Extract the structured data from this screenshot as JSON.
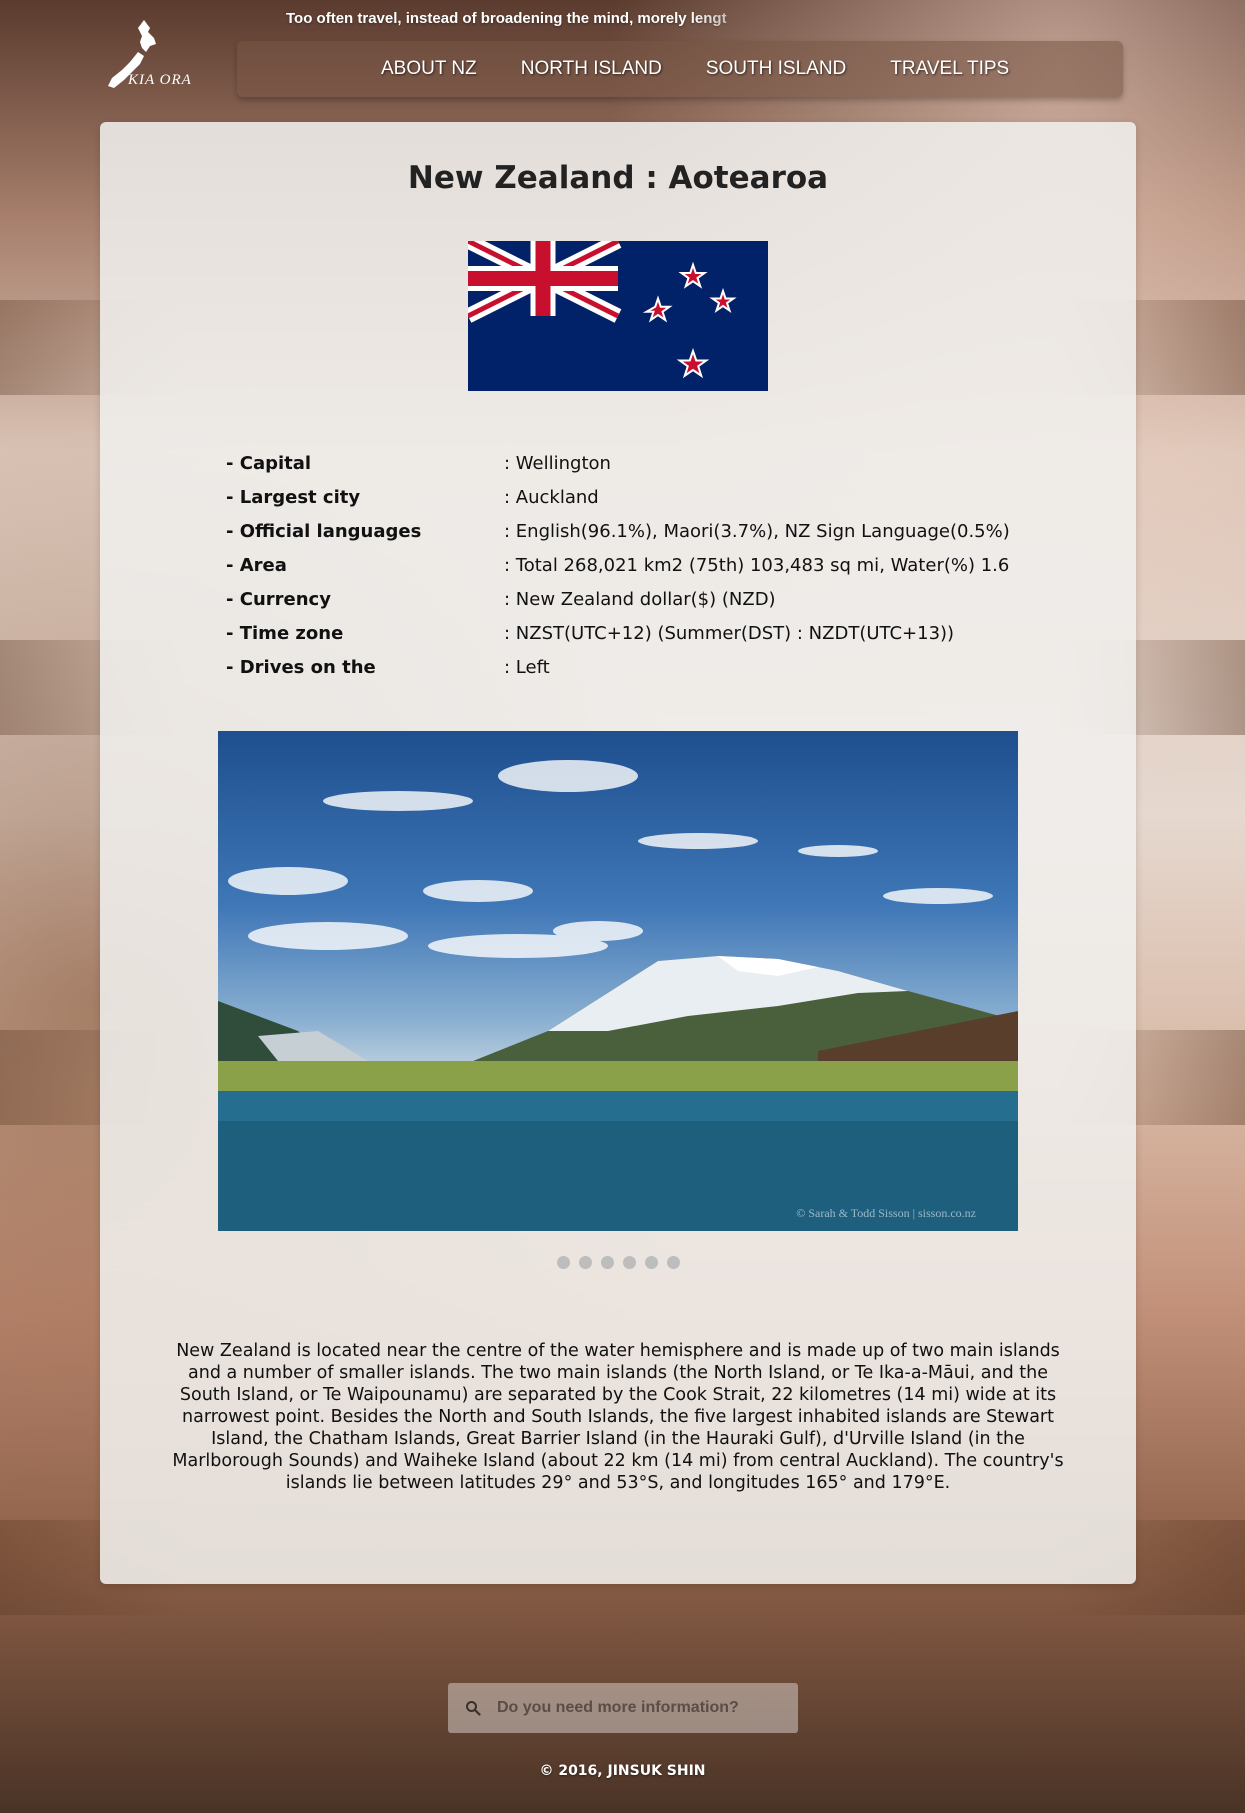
{
  "header": {
    "tagline": "Too often travel, instead of broadening the mind, morely lengt",
    "logo_text": "KIA ORA"
  },
  "nav": {
    "items": [
      {
        "label": "ABOUT NZ"
      },
      {
        "label": "NORTH ISLAND"
      },
      {
        "label": "SOUTH ISLAND"
      },
      {
        "label": "TRAVEL TIPS"
      }
    ]
  },
  "main": {
    "title": "New Zealand : Aotearoa",
    "facts": [
      {
        "label": "- Capital",
        "value": ": Wellington"
      },
      {
        "label": "- Largest city",
        "value": ": Auckland"
      },
      {
        "label": "- Official languages",
        "value": ": English(96.1%), Maori(3.7%), NZ Sign Language(0.5%)"
      },
      {
        "label": "- Area",
        "value": ": Total 268,021 km2 (75th) 103,483 sq mi, Water(%) 1.6"
      },
      {
        "label": "- Currency",
        "value": ": New Zealand dollar($) (NZD)"
      },
      {
        "label": "- Time zone",
        "value": ": NZST(UTC+12) (Summer(DST) : NZDT(UTC+13))"
      },
      {
        "label": "- Drives on the",
        "value": ": Left"
      }
    ],
    "photo_credit": "© Sarah & Todd Sisson | sisson.co.nz",
    "carousel_dots": 6,
    "description": "New Zealand is located near the centre of the water hemisphere and is made up of two main islands and a number of smaller islands. The two main islands (the North Island, or Te Ika-a-Māui, and the South Island, or Te Waipounamu) are separated by the Cook Strait, 22 kilometres (14 mi) wide at its narrowest point. Besides the North and South Islands, the five largest inhabited islands are Stewart Island, the Chatham Islands, Great Barrier Island (in the Hauraki Gulf), d'Urville Island (in the Marlborough Sounds) and Waiheke Island (about 22 km (14 mi) from central Auckland). The country's islands lie between latitudes 29° and 53°S, and longitudes 165° and 179°E."
  },
  "search": {
    "placeholder": "Do you need more information?",
    "value": ""
  },
  "footer": {
    "copyright": "© 2016, JINSUK SHIN"
  },
  "colors": {
    "flag_blue": "#012169",
    "flag_red": "#C8102E",
    "card_bg": "#f0efed"
  }
}
